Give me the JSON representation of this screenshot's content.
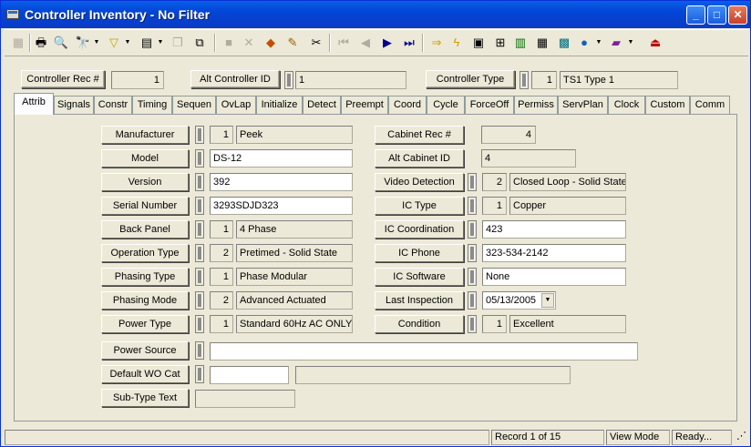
{
  "window": {
    "title": "Controller Inventory - No Filter"
  },
  "header": {
    "controller_rec_label": "Controller Rec #",
    "controller_rec_value": "1",
    "alt_controller_label": "Alt Controller ID",
    "alt_controller_value": "1",
    "controller_type_label": "Controller Type",
    "controller_type_code": "1",
    "controller_type_value": "TS1 Type 1"
  },
  "tabs": [
    "Attrib",
    "Signals",
    "Constr",
    "Timing",
    "Sequen",
    "OvLap",
    "Initialize",
    "Detect",
    "Preempt",
    "Coord",
    "Cycle",
    "ForceOff",
    "Permiss",
    "ServPlan",
    "Clock",
    "Custom",
    "Comm"
  ],
  "active_tab": "Attrib",
  "left": {
    "manufacturer": {
      "label": "Manufacturer",
      "code": "1",
      "value": "Peek"
    },
    "model": {
      "label": "Model",
      "value": "DS-12"
    },
    "version": {
      "label": "Version",
      "value": "392"
    },
    "serial": {
      "label": "Serial Number",
      "value": "3293SDJD323"
    },
    "back_panel": {
      "label": "Back Panel",
      "code": "1",
      "value": "4 Phase"
    },
    "operation_type": {
      "label": "Operation Type",
      "code": "2",
      "value": "Pretimed - Solid State"
    },
    "phasing_type": {
      "label": "Phasing Type",
      "code": "1",
      "value": "Phase Modular"
    },
    "phasing_mode": {
      "label": "Phasing Mode",
      "code": "2",
      "value": "Advanced Actuated"
    },
    "power_type": {
      "label": "Power Type",
      "code": "1",
      "value": "Standard 60Hz AC ONLY"
    },
    "power_source": {
      "label": "Power Source",
      "value": ""
    },
    "default_wo": {
      "label": "Default WO Cat",
      "value": "",
      "desc": ""
    },
    "sub_type": {
      "label": "Sub-Type Text",
      "value": ""
    }
  },
  "right": {
    "cabinet_rec": {
      "label": "Cabinet Rec #",
      "value": "4"
    },
    "alt_cabinet": {
      "label": "Alt Cabinet ID",
      "value": "4"
    },
    "video_detection": {
      "label": "Video Detection",
      "code": "2",
      "value": "Closed Loop - Solid State"
    },
    "ic_type": {
      "label": "IC Type",
      "code": "1",
      "value": "Copper"
    },
    "ic_coordination": {
      "label": "IC Coordination",
      "value": "423"
    },
    "ic_phone": {
      "label": "IC Phone",
      "value": "323-534-2142"
    },
    "ic_software": {
      "label": "IC Software",
      "value": "None"
    },
    "last_inspection": {
      "label": "Last Inspection",
      "value": "05/13/2005"
    },
    "condition": {
      "label": "Condition",
      "code": "1",
      "value": "Excellent"
    }
  },
  "status": {
    "record": "Record 1 of 15",
    "mode": "View Mode",
    "state": "Ready..."
  },
  "toolbar_icons": [
    "new-icon",
    "print-icon",
    "print-preview-icon",
    "find-icon",
    "filter-icon",
    "form-icon",
    "copy-icon",
    "paste-icon",
    "save-icon",
    "delete-icon",
    "layers-icon",
    "edit-icon",
    "cut-icon",
    "first-record-icon",
    "prev-record-icon",
    "next-record-icon",
    "last-record-icon",
    "goto-icon",
    "lightning-icon",
    "map-icon",
    "tree-icon",
    "chart-icon",
    "calculator-icon",
    "picture-icon",
    "globe-icon",
    "book-icon",
    "exit-icon"
  ]
}
